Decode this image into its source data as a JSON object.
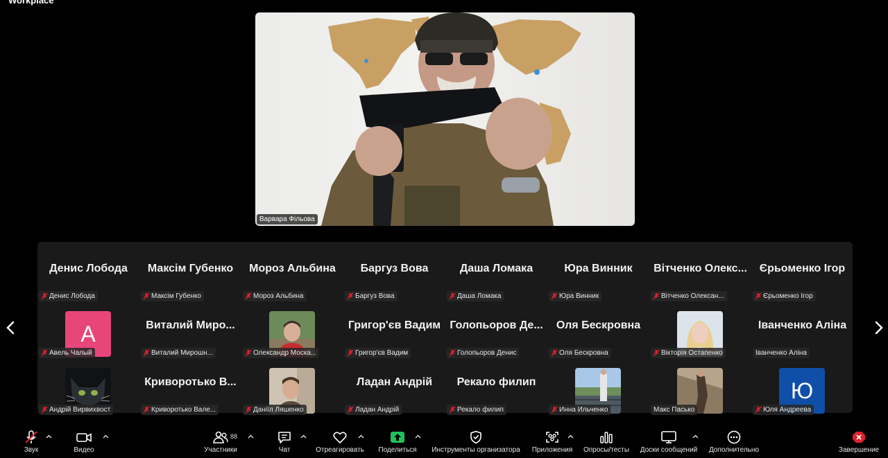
{
  "app": {
    "title": "Workplace"
  },
  "speaker": {
    "name": "Варвара Фільова"
  },
  "gallery": {
    "rows": [
      [
        {
          "big": "Денис Лобода",
          "label": "Денис Лобода"
        },
        {
          "big": "Максім Губенко",
          "label": "Максім Губенко"
        },
        {
          "big": "Мороз Альбина",
          "label": "Мороз Альбина"
        },
        {
          "big": "Баргуз Вова",
          "label": "Баргуз Вова"
        },
        {
          "big": "Даша Ломака",
          "label": "Даша Ломака"
        },
        {
          "big": "Юра Винник",
          "label": "Юра Винник"
        },
        {
          "big": "Вітченко Олекс...",
          "label": "Вітченко Олексан..."
        },
        {
          "big": "Єрьоменко Ігор",
          "label": "Єрьоменко Ігор"
        }
      ],
      [
        {
          "avatar_letter": "А",
          "avatar_color": "#e8467a",
          "label": "Авель Чалый"
        },
        {
          "big": "Виталий Миро...",
          "label": "Виталий Мирошн..."
        },
        {
          "photo": "man-outdoor",
          "label": "Олександр Моска..."
        },
        {
          "big": "Григор'єв Вадим",
          "label": "Григор'єв Вадим"
        },
        {
          "big": "Голопьоров Де...",
          "label": "Голопьоров Денис"
        },
        {
          "big": "Оля Бескровна",
          "label": "Оля Бескровна"
        },
        {
          "photo": "woman-blonde",
          "label": "Вікторія Остапенко"
        },
        {
          "big": "Іванченко Аліна",
          "label": "Іванченко Аліна",
          "no_mic": true
        }
      ],
      [
        {
          "photo": "cat-dark",
          "label": "Андрій Вирвихвост"
        },
        {
          "big": "Криворотько В...",
          "label": "Криворотько Вале..."
        },
        {
          "photo": "boy-indoor",
          "label": "Даніїл Ляшенко"
        },
        {
          "big": "Ладан Андрій",
          "label": "Ладан Андрій"
        },
        {
          "big": "Рекало филип",
          "label": "Рекало филип"
        },
        {
          "photo": "man-bridge",
          "label": "Инна Ильченко"
        },
        {
          "photo": "person-outdoor",
          "label": "Макс Пасько",
          "no_mic": true
        },
        {
          "avatar_letter": "Ю",
          "avatar_color": "#0f4fa8",
          "label": "Юля Андреева"
        }
      ]
    ]
  },
  "toolbar": {
    "audio": "Звук",
    "video": "Видео",
    "participants": "Участники",
    "participants_count": "88",
    "chat": "Чат",
    "react": "Отреагировать",
    "share": "Поделиться",
    "host_tools": "Инструменты организатора",
    "apps": "Приложения",
    "polls": "Опросы/тесты",
    "whiteboards": "Доски сообщений",
    "more": "Дополнительно",
    "end": "Завершение"
  },
  "colors": {
    "share_green": "#20c05c",
    "end_red": "#e0242f",
    "muted_red": "#e0242f"
  }
}
